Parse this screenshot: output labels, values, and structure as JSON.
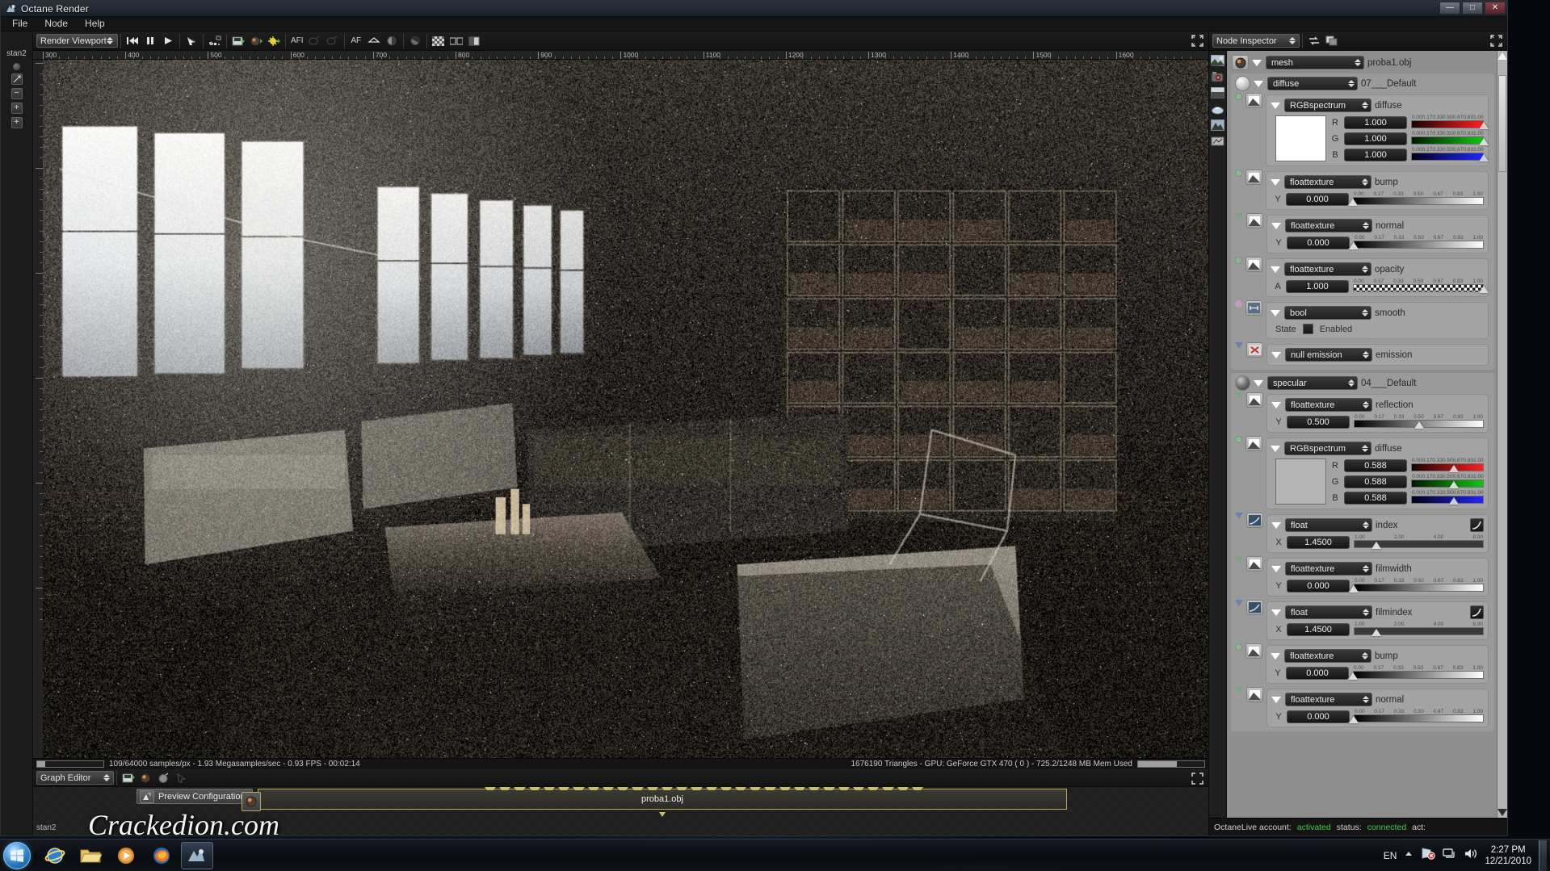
{
  "window": {
    "title": "Octane Render",
    "icon": "octane-logo-icon",
    "buttons": {
      "minimize": "—",
      "maximize": "□",
      "close": "✕"
    }
  },
  "menubar": {
    "items": [
      "File",
      "Node",
      "Help"
    ]
  },
  "viewport": {
    "panel_selector": "Render Viewport",
    "toolbar_icons": [
      "record-icon",
      "skip-to-start-icon",
      "pause-icon",
      "play-icon",
      "pick-focus-icon",
      "resolution-icon",
      "save-image-icon",
      "material-pick-icon",
      "light-pick-icon",
      "af-icon-1",
      "clone-disabled-icon",
      "clone2-disabled-icon",
      "af-icon-2",
      "focus-picker-icon",
      "render-region-icon",
      "crop-icon",
      "alpha-icon",
      "compare-icon",
      "layers-icon"
    ],
    "toolbar_text_icons": [
      "AFI",
      "AF"
    ],
    "expand_icon": "expand-viewport-icon",
    "ruler": {
      "labels": [
        "300",
        "400",
        "500",
        "600",
        "700",
        "800",
        "900",
        "1000",
        "1100",
        "1200",
        "1300",
        "1400",
        "1500",
        "1600"
      ],
      "start_value": 300,
      "step": 100
    },
    "status": {
      "progress_percent": 12,
      "render_stats": "109/64000 samples/px - 1.93 Megasamples/sec - 0.93 FPS - 00:02:14",
      "scene_stats": "1676190 Triangles - GPU: GeForce GTX 470 ( 0 ) - 725.2/1248 MB Mem Used",
      "memory_percent": 58
    },
    "left_rail_label": "stan2"
  },
  "graph_editor": {
    "panel_selector": "Graph Editor",
    "toolbar_icons": [
      "save-graph-icon",
      "load-material-icon",
      "copy-node-icon",
      "delete-node-icon"
    ],
    "expand_icon": "expand-graph-icon",
    "tooltip": "Preview Configuration",
    "tooltip_icon": "preview-config-icon",
    "node_label": "proba1.obj",
    "node_icon": "material-node-icon",
    "watermark": "Crackedion.com",
    "status_label": "stan2"
  },
  "inspector": {
    "panel_selector": "Node Inspector",
    "toolbar_icons": [
      "link-nodes-icon",
      "duplicate-node-icon"
    ],
    "expand_icon": "expand-inspector-icon",
    "rail_icons": [
      "image-icon",
      "camera-icon",
      "environment-icon",
      "material-icon",
      "mountain-icon",
      "kernel-icon"
    ],
    "scrollbar": {
      "up_icon": "scroll-up-icon",
      "down_icon": "scroll-down-icon"
    },
    "slider_ticks_unit": [
      "0.00",
      "0.17",
      "0.33",
      "0.50",
      "0.67",
      "0.83",
      "1.00"
    ],
    "slider_ticks_index": [
      "1.00",
      "2.00",
      "4.00",
      "8.00"
    ],
    "nodes": [
      {
        "id": "mesh",
        "type": "mesh",
        "name": "proba1.obj",
        "icon": "material-node-icon"
      },
      {
        "id": "diffuse-material",
        "type": "diffuse",
        "name": "07___Default",
        "icon": "sphere-preview-icon",
        "children": [
          {
            "id": "diffuse-color",
            "type": "RGBspectrum",
            "label": "diffuse",
            "icon": "texture-thumb-icon",
            "pin": "green",
            "swatch": "#ffffff",
            "channels": [
              {
                "axis": "R",
                "value": "1.000",
                "fraction": 1.0,
                "track": "red"
              },
              {
                "axis": "G",
                "value": "1.000",
                "fraction": 1.0,
                "track": "green"
              },
              {
                "axis": "B",
                "value": "1.000",
                "fraction": 1.0,
                "track": "blue"
              }
            ]
          },
          {
            "id": "diffuse-bump",
            "type": "floattexture",
            "label": "bump",
            "icon": "texture-thumb-icon",
            "pin": "green",
            "axis": "Y",
            "value": "0.000",
            "fraction": 0.0,
            "track": "grey"
          },
          {
            "id": "diffuse-normal",
            "type": "floattexture",
            "label": "normal",
            "icon": "texture-thumb-icon",
            "pin": "tri-g",
            "axis": "Y",
            "value": "0.000",
            "fraction": 0.0,
            "track": "grey"
          },
          {
            "id": "diffuse-opacity",
            "type": "floattexture",
            "label": "opacity",
            "icon": "texture-thumb-icon",
            "pin": "green",
            "axis": "A",
            "value": "1.000",
            "fraction": 1.0,
            "track": "checker"
          },
          {
            "id": "diffuse-smooth",
            "type": "bool",
            "label": "smooth",
            "icon": "bool-icon",
            "pin": "pink",
            "state_label": "State",
            "state_value": "Enabled"
          },
          {
            "id": "diffuse-emission",
            "type": "null emission",
            "label": "emission",
            "icon": "null-emission-icon",
            "pin": "tri-b"
          }
        ]
      },
      {
        "id": "specular-material",
        "type": "specular",
        "name": "04___Default",
        "icon": "sphere-preview-dark-icon",
        "children": [
          {
            "id": "specular-reflection",
            "type": "floattexture",
            "label": "reflection",
            "icon": "texture-thumb-icon",
            "pin": "tri-g",
            "axis": "Y",
            "value": "0.500",
            "fraction": 0.5,
            "track": "grey"
          },
          {
            "id": "specular-diffuse",
            "type": "RGBspectrum",
            "label": "diffuse",
            "icon": "texture-thumb-icon",
            "pin": "green",
            "swatch": "#b4b4b4",
            "channels": [
              {
                "axis": "R",
                "value": "0.588",
                "fraction": 0.588,
                "track": "red"
              },
              {
                "axis": "G",
                "value": "0.588",
                "fraction": 0.588,
                "track": "green"
              },
              {
                "axis": "B",
                "value": "0.588",
                "fraction": 0.588,
                "track": "blue"
              }
            ]
          },
          {
            "id": "specular-index",
            "type": "float",
            "label": "index",
            "icon": "curve-icon",
            "pin": "tri-b",
            "axis": "X",
            "value": "1.4500",
            "fraction": 0.175,
            "track": "plain",
            "scale": "index",
            "has_curve_button": true
          },
          {
            "id": "specular-filmwidth",
            "type": "floattexture",
            "label": "filmwidth",
            "icon": "texture-thumb-icon",
            "pin": "tri-g",
            "axis": "Y",
            "value": "0.000",
            "fraction": 0.0,
            "track": "grey"
          },
          {
            "id": "specular-filmindex",
            "type": "float",
            "label": "filmindex",
            "icon": "curve-icon",
            "pin": "tri-b",
            "axis": "X",
            "value": "1.4500",
            "fraction": 0.175,
            "track": "plain",
            "scale": "index",
            "has_curve_button": true
          },
          {
            "id": "specular-bump",
            "type": "floattexture",
            "label": "bump",
            "icon": "texture-thumb-icon",
            "pin": "green",
            "axis": "Y",
            "value": "0.000",
            "fraction": 0.0,
            "track": "grey"
          },
          {
            "id": "specular-normal",
            "type": "floattexture",
            "label": "normal",
            "icon": "texture-thumb-icon",
            "pin": "tri-g",
            "axis": "Y",
            "value": "0.000",
            "fraction": 0.0,
            "track": "grey"
          }
        ]
      }
    ],
    "statusbar": {
      "account_label": "OctaneLive account:",
      "account_value": "activated",
      "status_label": "status:",
      "status_value": "connected",
      "act_label": "act:",
      "ok_color": "#49c948"
    }
  },
  "taskbar": {
    "start_icon": "windows-start-orb",
    "items": [
      {
        "name": "internet-explorer-icon"
      },
      {
        "name": "explorer-folder-icon"
      },
      {
        "name": "media-player-icon"
      },
      {
        "name": "firefox-icon"
      },
      {
        "name": "octane-render-taskbar-icon",
        "active": true
      }
    ],
    "tray": {
      "language": "EN",
      "icons": [
        "show-hidden-icon",
        "action-center-flag-icon",
        "network-icon",
        "volume-icon"
      ],
      "time": "2:27 PM",
      "date": "12/21/2010"
    }
  }
}
